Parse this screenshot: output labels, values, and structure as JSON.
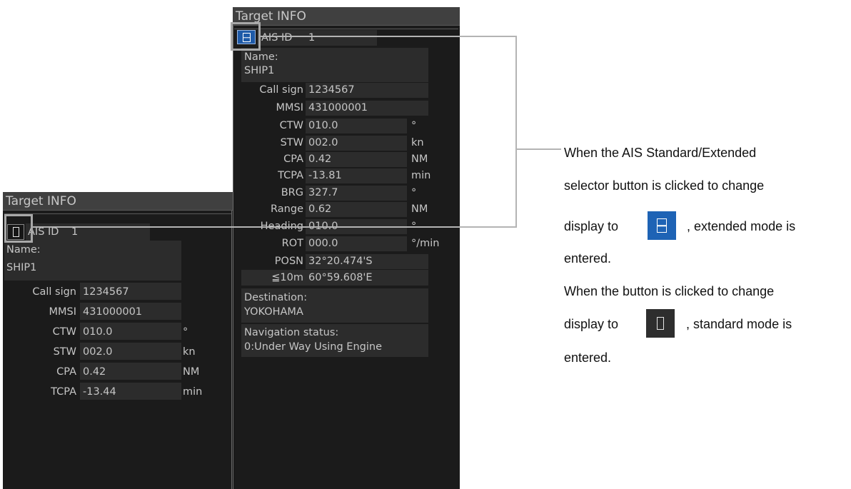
{
  "panel_left": {
    "title": "Target INFO",
    "ais_id_label": "AIS ID",
    "ais_id_value": "1",
    "name_label": "Name:",
    "name_value": "SHIP1",
    "rows": [
      {
        "label": "Call sign",
        "value": "1234567",
        "unit": ""
      },
      {
        "label": "MMSI",
        "value": "431000001",
        "unit": ""
      },
      {
        "label": "CTW",
        "value": "010.0",
        "unit": "°"
      },
      {
        "label": "STW",
        "value": "002.0",
        "unit": "kn"
      },
      {
        "label": "CPA",
        "value": "0.42",
        "unit": "NM"
      },
      {
        "label": "TCPA",
        "value": "-13.44",
        "unit": "min"
      }
    ]
  },
  "panel_right": {
    "title": "Target INFO",
    "ais_id_label": "AIS ID",
    "ais_id_value": "1",
    "name_label": "Name:",
    "name_value": "SHIP1",
    "rows": [
      {
        "label": "Call sign",
        "value": "1234567",
        "unit": ""
      },
      {
        "label": "MMSI",
        "value": "431000001",
        "unit": ""
      },
      {
        "label": "CTW",
        "value": "010.0",
        "unit": "°"
      },
      {
        "label": "STW",
        "value": "002.0",
        "unit": "kn"
      },
      {
        "label": "CPA",
        "value": "0.42",
        "unit": "NM"
      },
      {
        "label": "TCPA",
        "value": "-13.81",
        "unit": "min"
      },
      {
        "label": "BRG",
        "value": "327.7",
        "unit": "°"
      },
      {
        "label": "Range",
        "value": "0.62",
        "unit": "NM"
      },
      {
        "label": "Heading",
        "value": "010.0",
        "unit": "°"
      },
      {
        "label": "ROT",
        "value": "000.0",
        "unit": "°/min"
      },
      {
        "label": "POSN",
        "value": "32°20.474'S",
        "unit": ""
      },
      {
        "label": "≦10m",
        "value": "60°59.608'E",
        "unit": ""
      }
    ],
    "destination_label": "Destination:",
    "destination_value": "YOKOHAMA",
    "nav_status_label": "Navigation status:",
    "nav_status_value": "0:Under Way Using Engine"
  },
  "description": {
    "line1": "When the AIS Standard/Extended",
    "line2": "selector button is clicked to change",
    "line3_pre": "display to",
    "line3_post": ", extended mode is",
    "line4": "entered.",
    "line5": "When the button is clicked to change",
    "line6_pre": "display to",
    "line6_post": ", standard mode is",
    "line7": "entered."
  },
  "icons": {
    "standard_mode": "standard-mode-icon",
    "extended_mode": "extended-mode-icon"
  },
  "colors": {
    "panel_bg": "#1b1b1b",
    "field_bg": "#2c2c2c",
    "extended_button": "#1e5aa8",
    "callout_line": "#b4b4b4"
  }
}
